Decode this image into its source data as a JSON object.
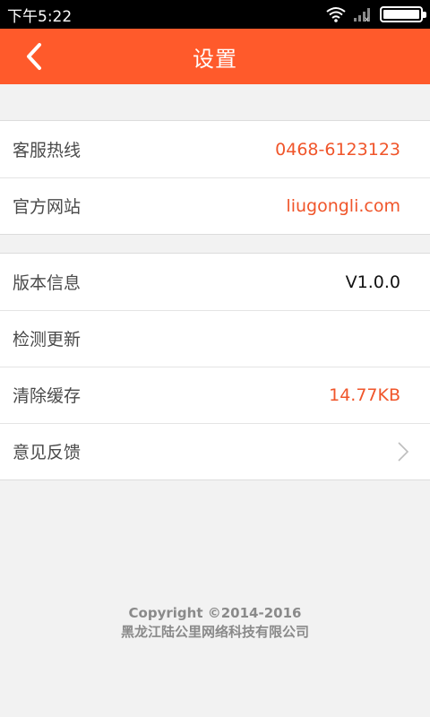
{
  "status_bar": {
    "time": "下午5:22",
    "icons": [
      "wifi-icon",
      "signal-icon",
      "battery-icon"
    ],
    "battery_level": 1.0
  },
  "app_bar": {
    "title": "设置",
    "back_icon": "chevron-left-icon",
    "color": "#ff5a2b"
  },
  "group1": [
    {
      "label": "客服热线",
      "value": "0468-6123123"
    },
    {
      "label": "官方网站",
      "value": "liugongli.com"
    }
  ],
  "group2": [
    {
      "label": "版本信息",
      "value": "V1.0.0"
    },
    {
      "label": "检测更新",
      "value": ""
    },
    {
      "label": "清除缓存",
      "value": "14.77KB"
    },
    {
      "label": "意见反馈",
      "value": "",
      "icon": "chevron-right-icon"
    }
  ],
  "footer": {
    "copyright": "Copyright ©2014-2016",
    "company": "黑龙江陆公里网络科技有限公司"
  },
  "colors": {
    "accent": "#ff5a2b",
    "value_orange": "#f0552a",
    "background": "#f2f2f2"
  }
}
